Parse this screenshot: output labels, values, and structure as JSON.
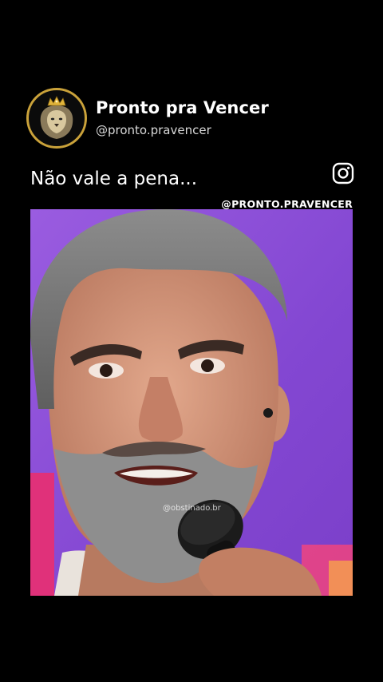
{
  "profile": {
    "name": "Pronto pra Vencer",
    "handle": "@pronto.pravencer",
    "avatar_icon": "crowned-lion-logo-icon"
  },
  "post": {
    "caption": "Não vale a pena...",
    "platform_icon": "instagram-icon",
    "watermark": "@PRONTO.PRAVENCER"
  },
  "video": {
    "overlay_watermark": "@obstinado.br"
  },
  "colors": {
    "background": "#000000",
    "text": "#ffffff",
    "avatar_ring": "#caa23a",
    "video_backdrop": "#8a4fd6",
    "accent_pink": "#e0317a"
  }
}
